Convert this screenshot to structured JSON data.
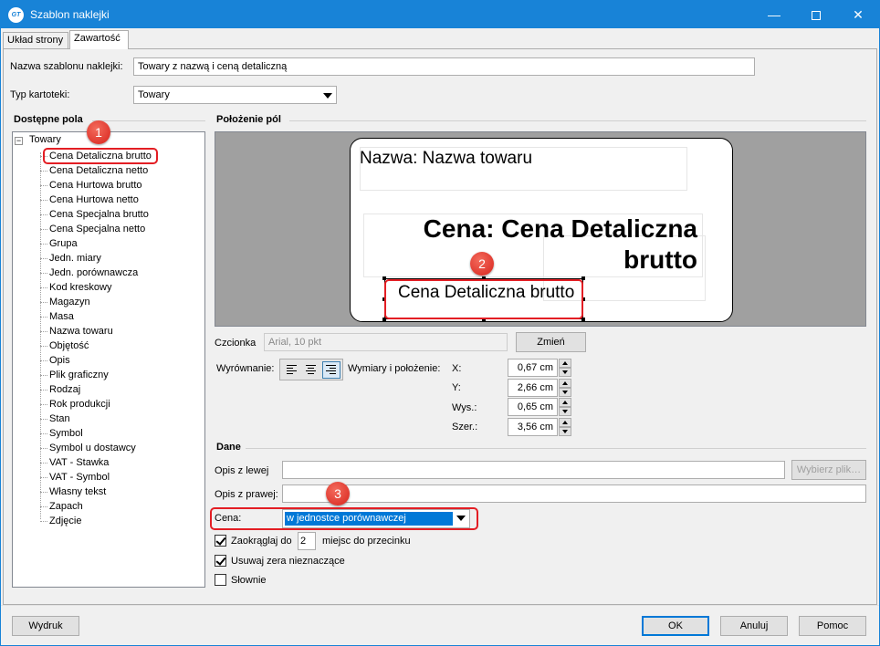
{
  "window": {
    "title": "Szablon naklejki",
    "app_icon": "subiekt-gt-icon",
    "controls": {
      "minimize": "—",
      "maximize": "",
      "close": "✕"
    }
  },
  "tabs": [
    {
      "label": "Układ strony",
      "active": false
    },
    {
      "label": "Zawartość",
      "active": true
    }
  ],
  "template_name": {
    "label": "Nazwa szablonu naklejki:",
    "value": "Towary z nazwą i ceną detaliczną"
  },
  "card_type": {
    "label": "Typ kartoteki:",
    "value": "Towary"
  },
  "fields": {
    "title": "Dostępne pola",
    "root": "Towary",
    "toggle": "−",
    "items": [
      "Cena Detaliczna brutto",
      "Cena Detaliczna netto",
      "Cena Hurtowa brutto",
      "Cena Hurtowa netto",
      "Cena Specjalna brutto",
      "Cena Specjalna netto",
      "Grupa",
      "Jedn. miary",
      "Jedn. porównawcza",
      "Kod kreskowy",
      "Magazyn",
      "Masa",
      "Nazwa towaru",
      "Objętość",
      "Opis",
      "Plik graficzny",
      "Rodzaj",
      "Rok produkcji",
      "Stan",
      "Symbol",
      "Symbol u dostawcy",
      "VAT - Stawka",
      "VAT - Symbol",
      "Własny tekst",
      "Zapach",
      "Zdjęcie"
    ],
    "selected_index": 0
  },
  "positions": {
    "title": "Położenie pól",
    "preview": {
      "name_text": "Nazwa:  Nazwa towaru",
      "price_line1": "Cena:  Cena Detaliczna",
      "price_line2": "brutto",
      "selected_field_text": "Cena Detaliczna brutto"
    }
  },
  "font": {
    "label": "Czcionka",
    "value": "Arial, 10 pkt",
    "change_button": "Zmień"
  },
  "alignment": {
    "label": "Wyrównanie:",
    "options": [
      "left",
      "center",
      "right"
    ],
    "selected": "right"
  },
  "dimensions": {
    "label": "Wymiary i położenie:",
    "x": {
      "label": "X:",
      "value": "0,67 cm"
    },
    "y": {
      "label": "Y:",
      "value": "2,66 cm"
    },
    "height": {
      "label": "Wys.:",
      "value": "0,65 cm"
    },
    "width": {
      "label": "Szer.:",
      "value": "3,56 cm"
    }
  },
  "data_section": {
    "title": "Dane",
    "left_desc": {
      "label": "Opis z lewej",
      "value": ""
    },
    "pick_file_button": "Wybierz plik…",
    "right_desc": {
      "label": "Opis z prawej:",
      "value": ""
    },
    "price": {
      "label": "Cena:",
      "value": "w jednostce porównawczej"
    },
    "round": {
      "label": "Zaokrąglaj do",
      "value": "2",
      "suffix": "miejsc do przecinku",
      "checked": true
    },
    "strip_zeros": {
      "label": "Usuwaj zera nieznaczące",
      "checked": true
    },
    "verbal": {
      "label": "Słownie",
      "checked": false
    }
  },
  "callouts": [
    "1",
    "2",
    "3"
  ],
  "footer": {
    "print": "Wydruk",
    "ok": "OK",
    "cancel": "Anuluj",
    "help": "Pomoc"
  },
  "colors": {
    "accent": "#1883d7",
    "callout": "#e31e24",
    "selection": "#0078d7"
  }
}
